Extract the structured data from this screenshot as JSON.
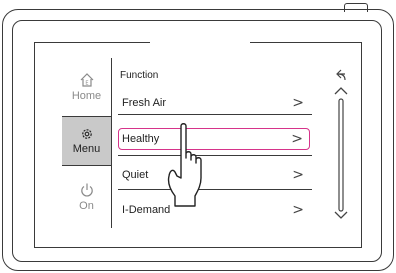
{
  "sidebar": {
    "items": [
      {
        "label": "Home",
        "icon": "home-icon",
        "active": false
      },
      {
        "label": "Menu",
        "icon": "gear-icon",
        "active": true
      },
      {
        "label": "On",
        "icon": "power-icon",
        "active": false
      }
    ]
  },
  "content": {
    "title": "Function",
    "items": [
      {
        "label": "Fresh Air",
        "chevron": ">"
      },
      {
        "label": "Healthy",
        "chevron": ">",
        "highlighted": true
      },
      {
        "label": "Quiet",
        "chevron": ">"
      },
      {
        "label": "I-Demand",
        "chevron": ">"
      }
    ]
  },
  "colors": {
    "highlight": "#d6338a",
    "active_tab": "#c9c9c9",
    "outline": "#3a3a3a"
  },
  "icons": {
    "back": "back-arrow-icon",
    "scroll_up": "scroll-up-icon",
    "scroll_down": "scroll-down-icon",
    "pointer": "hand-pointer-icon"
  }
}
